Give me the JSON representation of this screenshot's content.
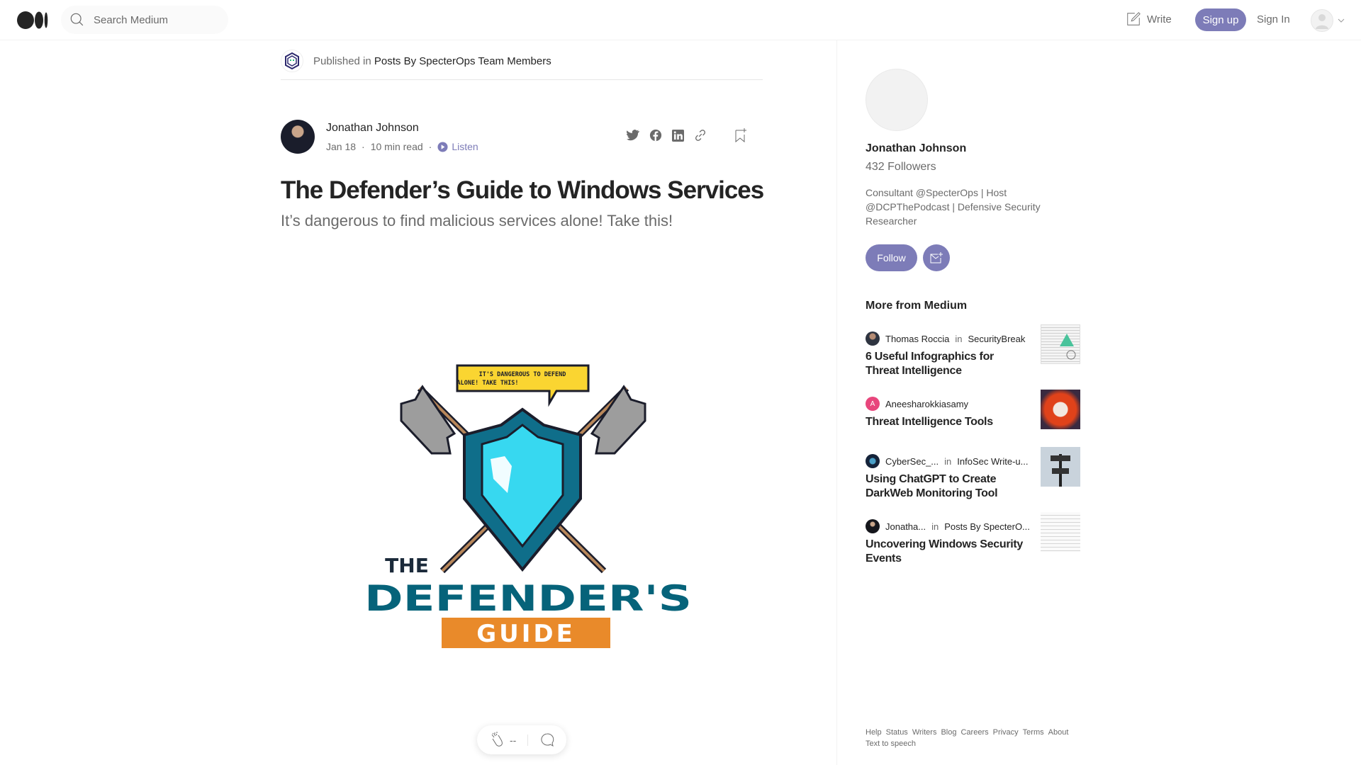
{
  "header": {
    "search_placeholder": "Search Medium",
    "write": "Write",
    "signup": "Sign up",
    "signin": "Sign In"
  },
  "publication": {
    "prefix": "Published in",
    "name": "Posts By SpecterOps Team Members"
  },
  "article": {
    "author": "Jonathan Johnson",
    "date": "Jan 18",
    "read_time": "10 min read",
    "listen": "Listen",
    "title": "The Defender’s Guide to Windows Services",
    "subtitle": "It’s dangerous to find malicious services alone! Take this!",
    "hero": {
      "bubble_line1": "IT'S DANGEROUS TO DEFEND",
      "bubble_line2": "ALONE! TAKE THIS!",
      "the": "THE",
      "defenders": "DEFENDER'S",
      "guide": "GUIDE"
    },
    "claps": "--",
    "share_icons": [
      "twitter-icon",
      "facebook-icon",
      "linkedin-icon",
      "link-icon",
      "bookmark-add-icon"
    ]
  },
  "profile": {
    "name": "Jonathan Johnson",
    "followers": "432 Followers",
    "bio": "Consultant @SpecterOps | Host @DCPThePodcast | Defensive Security Researcher",
    "follow": "Follow"
  },
  "more": {
    "heading": "More from Medium",
    "items": [
      {
        "author": "Thomas Roccia",
        "in": "in",
        "pub": "SecurityBreak",
        "title": "6 Useful Infographics for Threat Intelligence"
      },
      {
        "author": "Aneesharokkiasamy",
        "avatar_letter": "A",
        "title": "Threat Intelligence Tools"
      },
      {
        "author": "CyberSec_...",
        "in": "in",
        "pub": "InfoSec Write-u...",
        "title": "Using ChatGPT to Create DarkWeb Monitoring Tool"
      },
      {
        "author": "Jonatha...",
        "in": "in",
        "pub": "Posts By SpecterO...",
        "title": "Uncovering Windows Security Events"
      }
    ]
  },
  "footer": {
    "links": [
      "Help",
      "Status",
      "Writers",
      "Blog",
      "Careers",
      "Privacy",
      "Terms",
      "About"
    ],
    "tts": "Text to speech"
  },
  "colors": {
    "accent": "#7d7cb8",
    "text": "#242424",
    "muted": "#6b6b6b"
  }
}
